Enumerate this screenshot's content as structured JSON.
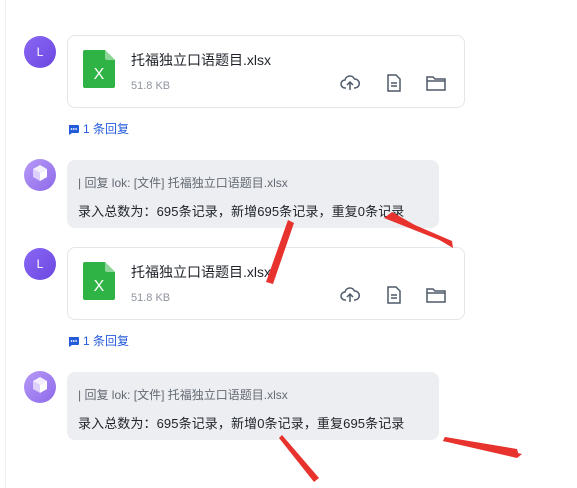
{
  "messages": [
    {
      "type": "file",
      "avatar_letter": "L",
      "file_name": "托福独立口语题目.xlsx",
      "file_size": "51.8 KB",
      "reply_count_label": "1 条回复"
    },
    {
      "type": "bot_reply",
      "quote": "| 回复 lok: [文件] 托福独立口语题目.xlsx",
      "text": "录入总数为：695条记录，新增695条记录，重复0条记录"
    },
    {
      "type": "file",
      "avatar_letter": "L",
      "file_name": "托福独立口语题目.xlsx",
      "file_size": "51.8 KB",
      "reply_count_label": "1 条回复"
    },
    {
      "type": "bot_reply",
      "quote": "| 回复 lok: [文件] 托福独立口语题目.xlsx",
      "text": "录入总数为：695条记录，新增0条记录，重复695条记录"
    }
  ],
  "icons": {
    "file": "excel-file-icon",
    "upload": "cloud-upload-icon",
    "preview": "document-icon",
    "folder": "folder-icon",
    "reply": "comment-icon",
    "bot": "cube-icon"
  },
  "colors": {
    "accent": "#245bdb",
    "excel_green": "#2fb344",
    "annotation_red": "#e8322e",
    "avatar_purple": "#7b57ea"
  }
}
